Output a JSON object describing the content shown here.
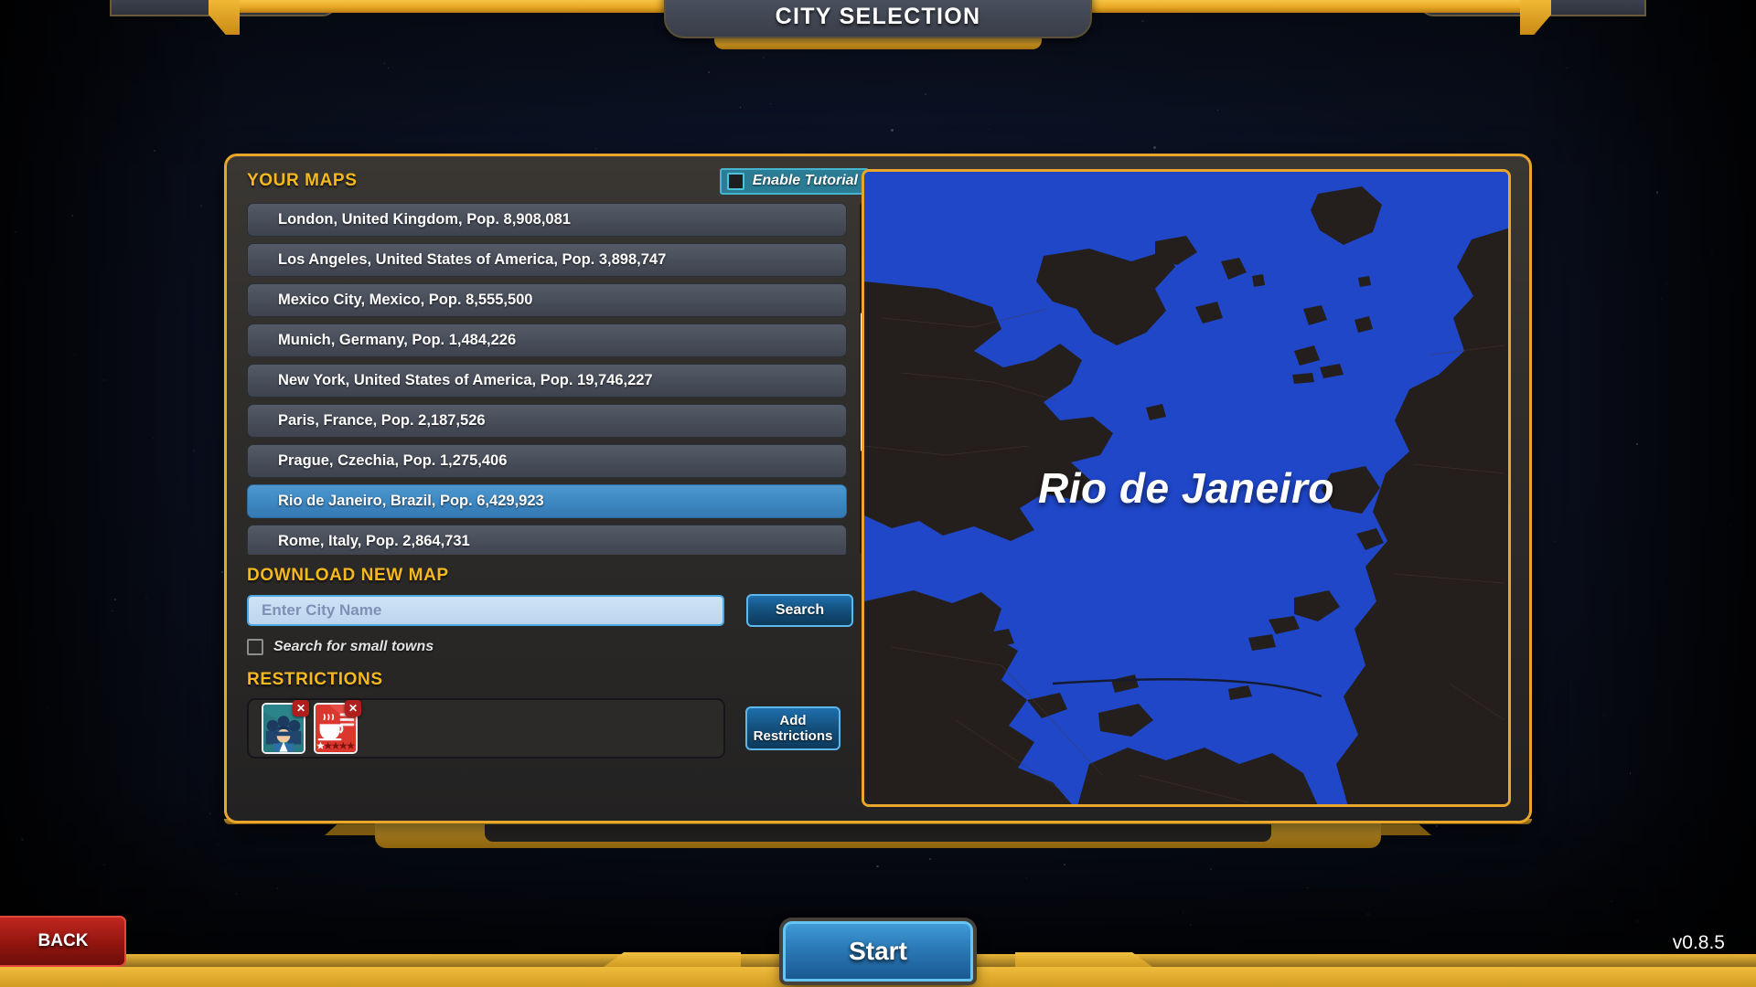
{
  "window": {
    "title": "CITY SELECTION",
    "version": "v0.8.5"
  },
  "colors": {
    "gold": "#e8a62a",
    "accent_blue": "#3d87c2",
    "selection_blue": "#4e98cf",
    "teal": "#2b7d96",
    "danger_red": "#92150f",
    "water_blue": "#1f47c8",
    "land_dark": "#241f1d"
  },
  "your_maps": {
    "header": "YOUR MAPS",
    "tutorial": {
      "label": "Enable Tutorial",
      "checked": false,
      "checkbox_icon": "checkbox-empty-icon"
    },
    "items": [
      {
        "label": "London, United Kingdom, Pop. 8,908,081",
        "selected": false
      },
      {
        "label": "Los Angeles, United States of America, Pop. 3,898,747",
        "selected": false
      },
      {
        "label": "Mexico City, Mexico, Pop. 8,555,500",
        "selected": false
      },
      {
        "label": "Munich, Germany, Pop. 1,484,226",
        "selected": false
      },
      {
        "label": "New York, United States of America, Pop. 19,746,227",
        "selected": false
      },
      {
        "label": "Paris, France, Pop. 2,187,526",
        "selected": false
      },
      {
        "label": "Prague, Czechia, Pop. 1,275,406",
        "selected": false
      },
      {
        "label": "Rio de Janeiro, Brazil, Pop. 6,429,923",
        "selected": true
      },
      {
        "label": "Rome, Italy, Pop. 2,864,731",
        "selected": false
      }
    ],
    "scrollbar": {
      "icon": "vertical-scrollbar",
      "thumb_position_pct": 31
    }
  },
  "download_new_map": {
    "header": "DOWNLOAD NEW MAP",
    "city_input": {
      "value": "",
      "placeholder": "Enter City Name"
    },
    "search_button": "Search",
    "small_towns": {
      "label": "Search for small towns",
      "checked": false,
      "checkbox_icon": "checkbox-empty-icon"
    }
  },
  "restrictions": {
    "header": "RESTRICTIONS",
    "cards": [
      {
        "name": "police-restriction-card",
        "icon": "police-officers-icon",
        "remove_icon": "x-remove-icon",
        "remove_label": "✕"
      },
      {
        "name": "cafe-restriction-card",
        "icon": "coffee-cup-icon",
        "remove_icon": "x-remove-icon",
        "remove_label": "✕",
        "stars": 5
      }
    ],
    "add_button_line1": "Add",
    "add_button_line2": "Restrictions"
  },
  "map_preview": {
    "city_label": "Rio de Janeiro"
  },
  "footer": {
    "back_button": "BACK",
    "start_button": "Start"
  }
}
